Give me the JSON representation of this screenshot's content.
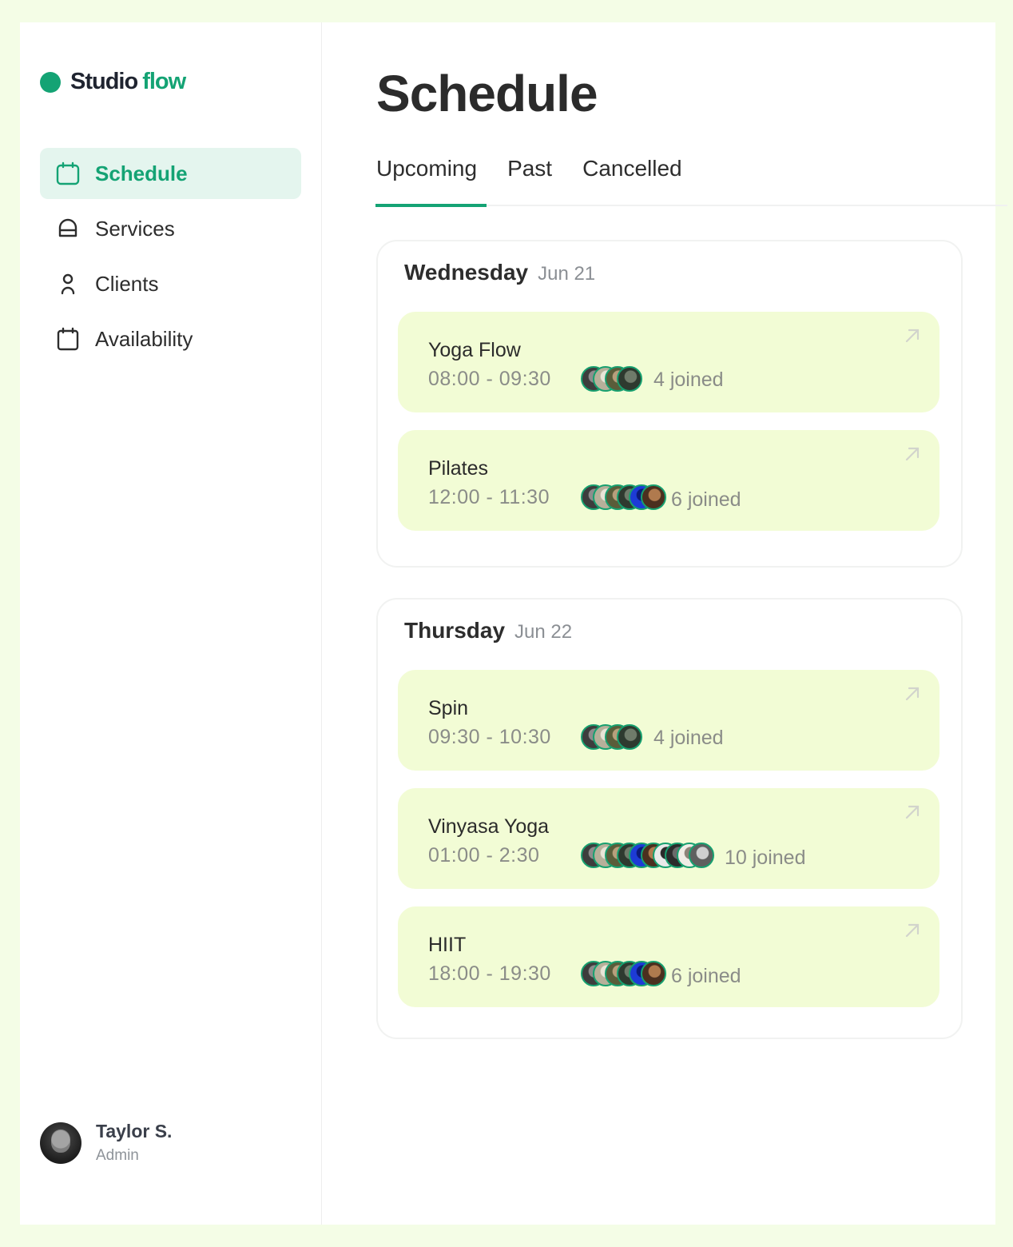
{
  "brand": {
    "name": "Studio",
    "accent": "flow",
    "accent_color": "#14a374"
  },
  "sidebar": {
    "items": [
      {
        "label": "Schedule",
        "icon": "calendar-icon",
        "active": true
      },
      {
        "label": "Services",
        "icon": "helmet-icon",
        "active": false
      },
      {
        "label": "Clients",
        "icon": "user-icon",
        "active": false
      },
      {
        "label": "Availability",
        "icon": "calendar-outline-icon",
        "active": false
      }
    ]
  },
  "user": {
    "name": "Taylor S.",
    "role": "Admin"
  },
  "main": {
    "title": "Schedule",
    "tabs": [
      {
        "label": "Upcoming",
        "active": true
      },
      {
        "label": "Past",
        "active": false
      },
      {
        "label": "Cancelled",
        "active": false
      }
    ],
    "days": [
      {
        "day": "Wednesday",
        "date": "Jun 21",
        "sessions": [
          {
            "name": "Yoga Flow",
            "time": "08:00 - 09:30",
            "joined": "4 joined"
          },
          {
            "name": "Pilates",
            "time": "12:00 - 11:30",
            "joined": "6 joined"
          }
        ]
      },
      {
        "day": "Thursday",
        "date": "Jun 22",
        "sessions": [
          {
            "name": "Spin",
            "time": "09:30 - 10:30",
            "joined": "4 joined"
          },
          {
            "name": "Vinyasa Yoga",
            "time": "01:00 - 2:30",
            "joined": "10 joined"
          },
          {
            "name": "HIIT",
            "time": "18:00 - 19:30",
            "joined": "6 joined"
          }
        ]
      }
    ]
  },
  "colors": {
    "accent": "#14a374",
    "session_bg": "#f2fcd5",
    "page_bg": "#f4fde6"
  }
}
